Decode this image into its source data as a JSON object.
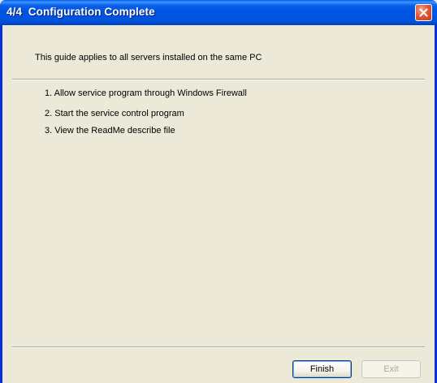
{
  "window": {
    "title": "4/4  Configuration Complete"
  },
  "intro_text": "This guide applies to all servers installed on the same PC",
  "steps": [
    "1. Allow service program through Windows Firewall",
    "2. Start the service control program",
    "3. View the ReadMe describe file"
  ],
  "buttons": {
    "finish_label": "Finish",
    "exit_label": "Exit",
    "exit_enabled": false
  },
  "colors": {
    "title_bar": "#0054e3",
    "client_bg": "#ece9d8",
    "close_button": "#e2593a",
    "disabled_text": "#aca899"
  },
  "icons": {
    "close": "close-icon"
  }
}
